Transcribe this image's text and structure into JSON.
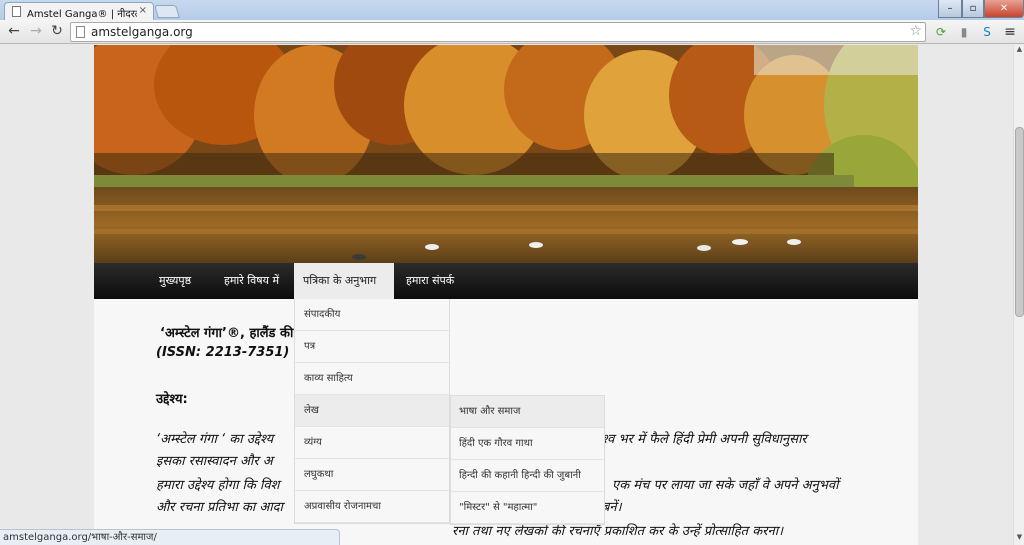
{
  "browser": {
    "tab_title": "Amstel Ganga® | नीदरलैंड",
    "tab_close": "×",
    "url": "amstelganga.org",
    "back": "←",
    "forward": "→",
    "reload": "↻",
    "star": "☆",
    "menu": "≡",
    "min": "–",
    "max": "▫",
    "close": "✕",
    "status_url": "amstelganga.org/भाषा-और-समाज/"
  },
  "nav": {
    "items": [
      "मुख्यपृष्ठ",
      "हमारे विषय में",
      "पत्रिका के अनुभाग",
      "हमारा संपर्क"
    ]
  },
  "dropdown": {
    "items": [
      "संपादकीय",
      "पत्र",
      "काव्य साहित्य",
      "लेख",
      "व्यंग्य",
      "लघुकथा",
      "अप्रवासीय रोजनामचा"
    ]
  },
  "subdropdown": {
    "items": [
      "भाषा और समाज",
      "हिंदी एक गौरव गाथा",
      "हिन्दी की कहानी हिन्दी की जुबानी",
      "\"मिस्टर\" से \"महात्मा\""
    ]
  },
  "content": {
    "title_line": "‘अम्स्टेल गंगा’®, हालैंड की",
    "issn": "(ISSN: 2213-7351)",
    "objective_heading": "उद्देश्य:",
    "para1_left": "‘अम्स्टेल गंगा ‘ का उद्देश्य",
    "para1_right": "विश्व भर में फैले हिंदी प्रेमी अपनी सुविधानुसार",
    "para2_left": "इसका रसास्वादन और अ",
    "para3_left": "हमारा उद्देश्य होगा कि विश",
    "para3_right": "एक मंच पर लाया जा सके जहाँ वे अपने अनुभवों",
    "para4_left": "और रचना प्रतिभा का आदा",
    "para4_right": "बनें।",
    "para5_right": "रना तथा नए लेखकों की रचनाएँ प्रकाशित कर के उन्हें प्रोत्साहित करना।"
  },
  "colors": {
    "nav_bg": "#111111",
    "page_bg": "#e9e9e9",
    "content_bg": "#f7f7f7"
  }
}
